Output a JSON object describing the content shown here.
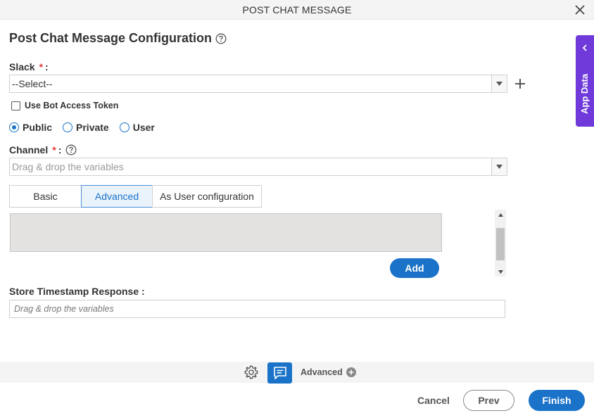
{
  "dialog": {
    "title": "POST CHAT MESSAGE"
  },
  "config": {
    "heading": "Post Chat Message Configuration"
  },
  "slack": {
    "label": "Slack",
    "required_mark": "*",
    "colon": ":",
    "selected": "--Select--"
  },
  "bot_token": {
    "label": "Use Bot Access Token",
    "checked": false
  },
  "visibility": {
    "options": [
      "Public",
      "Private",
      "User"
    ],
    "selected": "Public"
  },
  "channel": {
    "label": "Channel",
    "required_mark": "*",
    "colon": ":",
    "placeholder": "Drag & drop the variables"
  },
  "tabs": {
    "items": [
      "Basic",
      "Advanced",
      "As User configuration"
    ],
    "active": "Advanced"
  },
  "add_button": "Add",
  "store_timestamp": {
    "label": "Store Timestamp Response :",
    "placeholder": "Drag & drop the variables"
  },
  "footer": {
    "advanced_label": "Advanced",
    "cancel": "Cancel",
    "prev": "Prev",
    "finish": "Finish"
  },
  "side_panel": {
    "label": "App Data"
  },
  "colors": {
    "primary": "#1a73c8",
    "side_panel": "#6f3ad9",
    "required": "#e53935"
  }
}
